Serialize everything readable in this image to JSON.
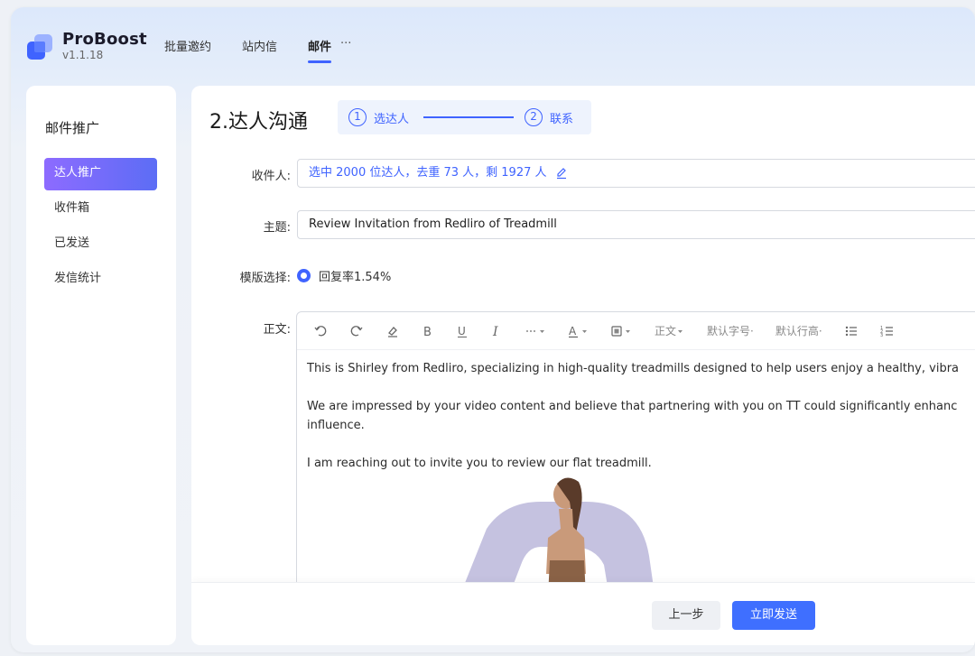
{
  "app": {
    "name": "ProBoost",
    "version": "v1.1.18"
  },
  "nav": {
    "items": [
      "批量邀约",
      "站内信",
      "邮件"
    ],
    "active": "邮件",
    "more": "···"
  },
  "sidebar": {
    "title": "邮件推广",
    "items": [
      {
        "label": "达人推广",
        "active": true
      },
      {
        "label": "收件箱"
      },
      {
        "label": "已发送"
      },
      {
        "label": "发信统计"
      }
    ]
  },
  "main": {
    "title": "2.达人沟通",
    "steps": [
      {
        "num": "1",
        "label": "选达人"
      },
      {
        "num": "2",
        "label": "联系"
      }
    ],
    "recipient": {
      "label": "收件人:",
      "value": "选中 2000 位达人，去重 73 人，剩 1927 人"
    },
    "subject": {
      "label": "主题:",
      "value": "Review Invitation from Redliro of Treadmill"
    },
    "template": {
      "label": "模版选择:",
      "option": "回复率1.54%"
    },
    "body_label": "正文:",
    "toolbar": {
      "format": "正文",
      "font_size": "默认字号",
      "line_height": "默认行高"
    },
    "body": {
      "p1": "This is Shirley from Redliro, specializing in high-quality treadmills designed to help users enjoy a healthy, vibra",
      "p2a": "We are impressed by your video content and believe that partnering with you on TT could significantly enhanc",
      "p2b": "influence.",
      "p3": "I am reaching out to invite you to review our flat treadmill."
    }
  },
  "footer": {
    "prev_label": "上一步",
    "send_label": "立即发送"
  },
  "colors": {
    "accent": "#3f63ff",
    "sidebar_active_start": "#8d6bff",
    "sidebar_active_end": "#5c6df5"
  }
}
